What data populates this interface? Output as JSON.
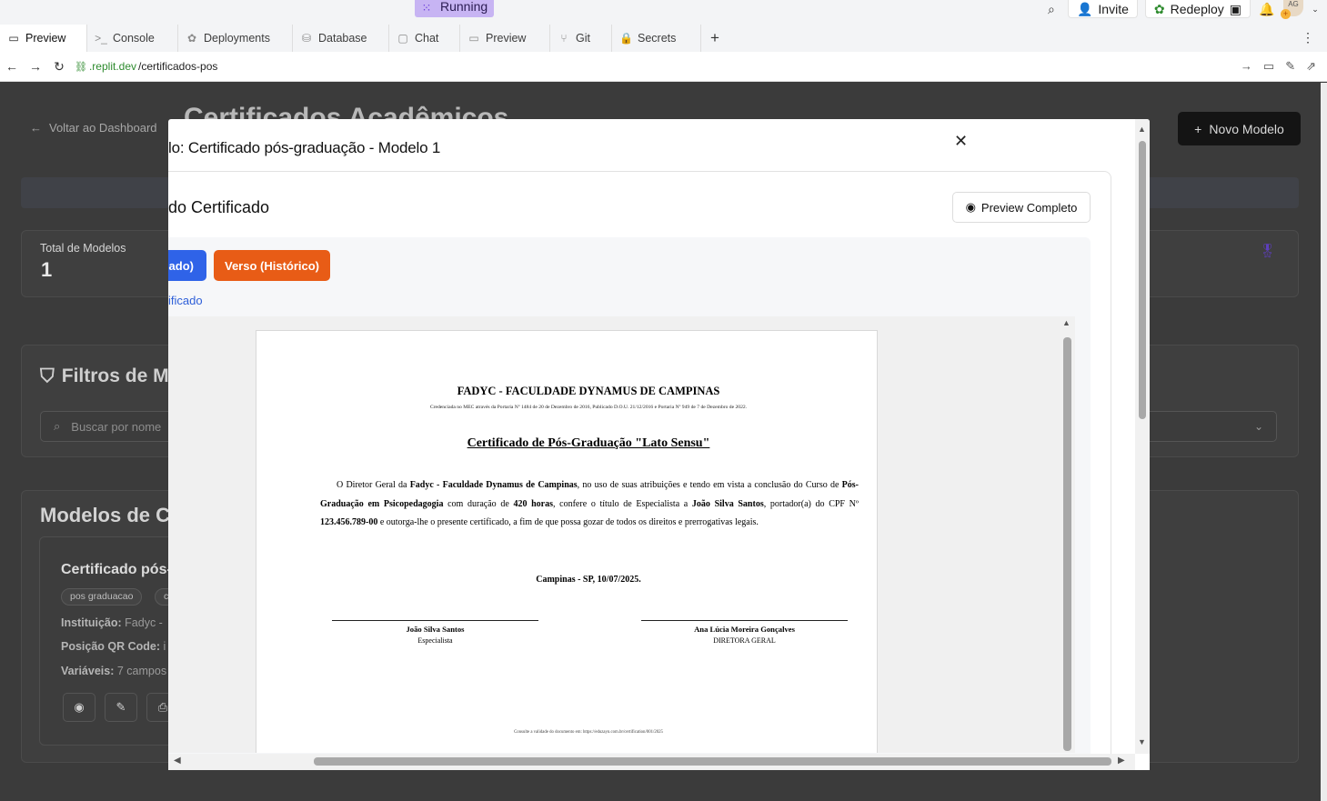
{
  "topbar": {
    "run_label": "Running",
    "invite_label": "Invite",
    "redeploy_label": "Redeploy",
    "avatar_initials": "AG"
  },
  "tabs": [
    {
      "label": "Preview",
      "icon": "monitor-icon"
    },
    {
      "label": "Console",
      "icon": "terminal-icon"
    },
    {
      "label": "Deployments",
      "icon": "deploy-icon"
    },
    {
      "label": "Database",
      "icon": "database-icon"
    },
    {
      "label": "Chat",
      "icon": "chat-icon"
    },
    {
      "label": "Preview",
      "icon": "monitor-icon"
    },
    {
      "label": "Git",
      "icon": "git-icon"
    },
    {
      "label": "Secrets",
      "icon": "lock-icon"
    }
  ],
  "address": {
    "domain": ".replit.dev",
    "path": "/certificados-pos"
  },
  "app": {
    "back_label": "Voltar ao Dashboard",
    "page_title": "Certificados Acadêmicos",
    "new_model_label": "Novo Modelo",
    "stat_label": "Total de Modelos",
    "stat_value": "1",
    "filters_title": "Filtros de M",
    "search_placeholder": "Buscar por nome",
    "models_title": "Modelos de Ce",
    "model_card": {
      "title": "Certificado pós-",
      "tag1": "pos graduacao",
      "tag2": "c",
      "institution_label": "Instituição:",
      "institution_value": "Fadyc -",
      "qr_label": "Posição QR Code:",
      "qr_value": "i",
      "vars_label": "Variáveis:",
      "vars_value": "7 campos"
    }
  },
  "modal": {
    "title": "lo: Certificado pós-graduação - Modelo 1",
    "section_title": "do Certificado",
    "preview_full_label": "Preview Completo",
    "front_label": "ado)",
    "back_label": "Verso (Histórico)",
    "link_fragment": "ificado"
  },
  "certificate": {
    "institution": "FADYC - FACULDADE DYNAMUS DE CAMPINAS",
    "accreditation": "Credenciada no MEC através da Portaria Nº 1484 de 20 de Dezembro de 2016, Publicado D.O.U. 21/12/2016 e Portaria Nº 949 de 7 de Dezembro de 2022.",
    "title": "Certificado de Pós-Graduação \"Lato Sensu\"",
    "body_p1": "O Diretor Geral da ",
    "body_b1": "Fadyc - Faculdade Dynamus de Campinas",
    "body_p2": ", no uso de suas atribuições e tendo em vista a conclusão do Curso de ",
    "body_b2": "Pós-Graduação em Psicopedagogia",
    "body_p3": " com duração de ",
    "body_b3": "420 horas",
    "body_p4": ", confere o título de Especialista a ",
    "body_b4": "João Silva Santos",
    "body_p5": ", portador(a) do CPF Nº ",
    "body_b5": "123.456.789-00",
    "body_p6": " e outorga-lhe o presente certificado, a fim de que possa gozar de todos os direitos e prerrogativas legais.",
    "place_date": "Campinas - SP, 10/07/2025.",
    "sig1_name": "João Silva Santos",
    "sig1_role": "Especialista",
    "sig2_name": "Ana Lúcia Moreira Gonçalves",
    "sig2_role": "DIRETORA GERAL",
    "footer": "Consulte a validade do documento em: https://eduzayn.com.br/certification/001/2025"
  }
}
